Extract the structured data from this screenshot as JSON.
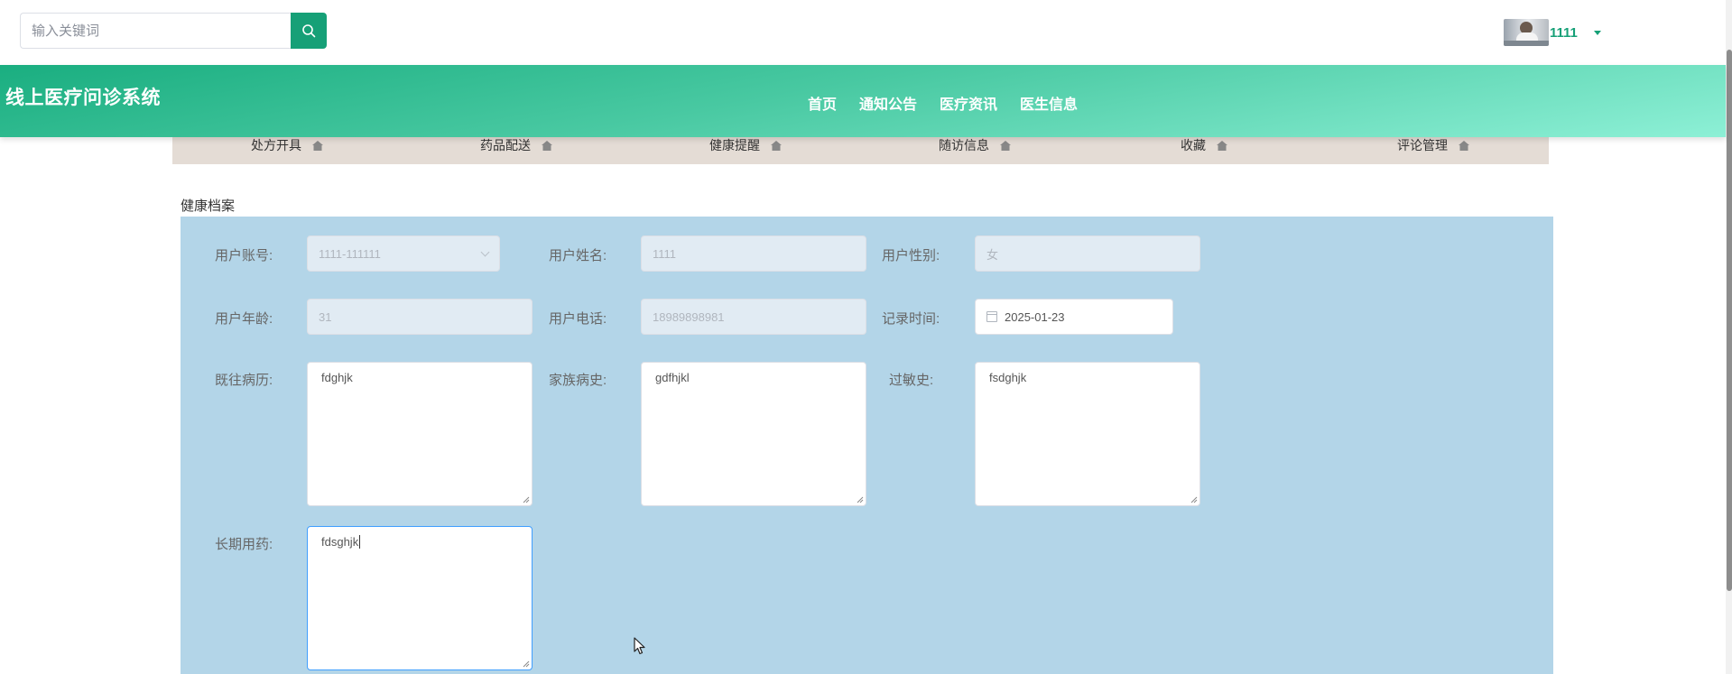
{
  "search": {
    "placeholder": "输入关键词"
  },
  "user": {
    "name": "1111"
  },
  "header": {
    "site_title": "线上医疗问诊系统"
  },
  "nav": {
    "items": [
      "首页",
      "通知公告",
      "医疗资讯",
      "医生信息"
    ]
  },
  "subnav": {
    "items": [
      "处方开具",
      "药品配送",
      "健康提醒",
      "随访信息",
      "收藏",
      "评论管理"
    ]
  },
  "section": {
    "title": "健康档案"
  },
  "form": {
    "account": {
      "label": "用户账号:",
      "value": "1111-111111"
    },
    "name": {
      "label": "用户姓名:",
      "value": "1111"
    },
    "gender": {
      "label": "用户性别:",
      "value": "女"
    },
    "age": {
      "label": "用户年龄:",
      "value": "31"
    },
    "phone": {
      "label": "用户电话:",
      "value": "18989898981"
    },
    "record_time": {
      "label": "记录时间:",
      "value": "2025-01-23"
    },
    "past_history": {
      "label": "既往病历:",
      "value": "fdghjk"
    },
    "family_history": {
      "label": "家族病史:",
      "value": "gdfhjkl"
    },
    "allergy": {
      "label": "过敏史:",
      "value": "fsdghjk"
    },
    "long_term_meds": {
      "label": "长期用药:",
      "value": "fdsghjk"
    }
  },
  "colors": {
    "accent": "#16a077",
    "panel": "#b3d5e8",
    "subnav": "#e4dcd5"
  }
}
